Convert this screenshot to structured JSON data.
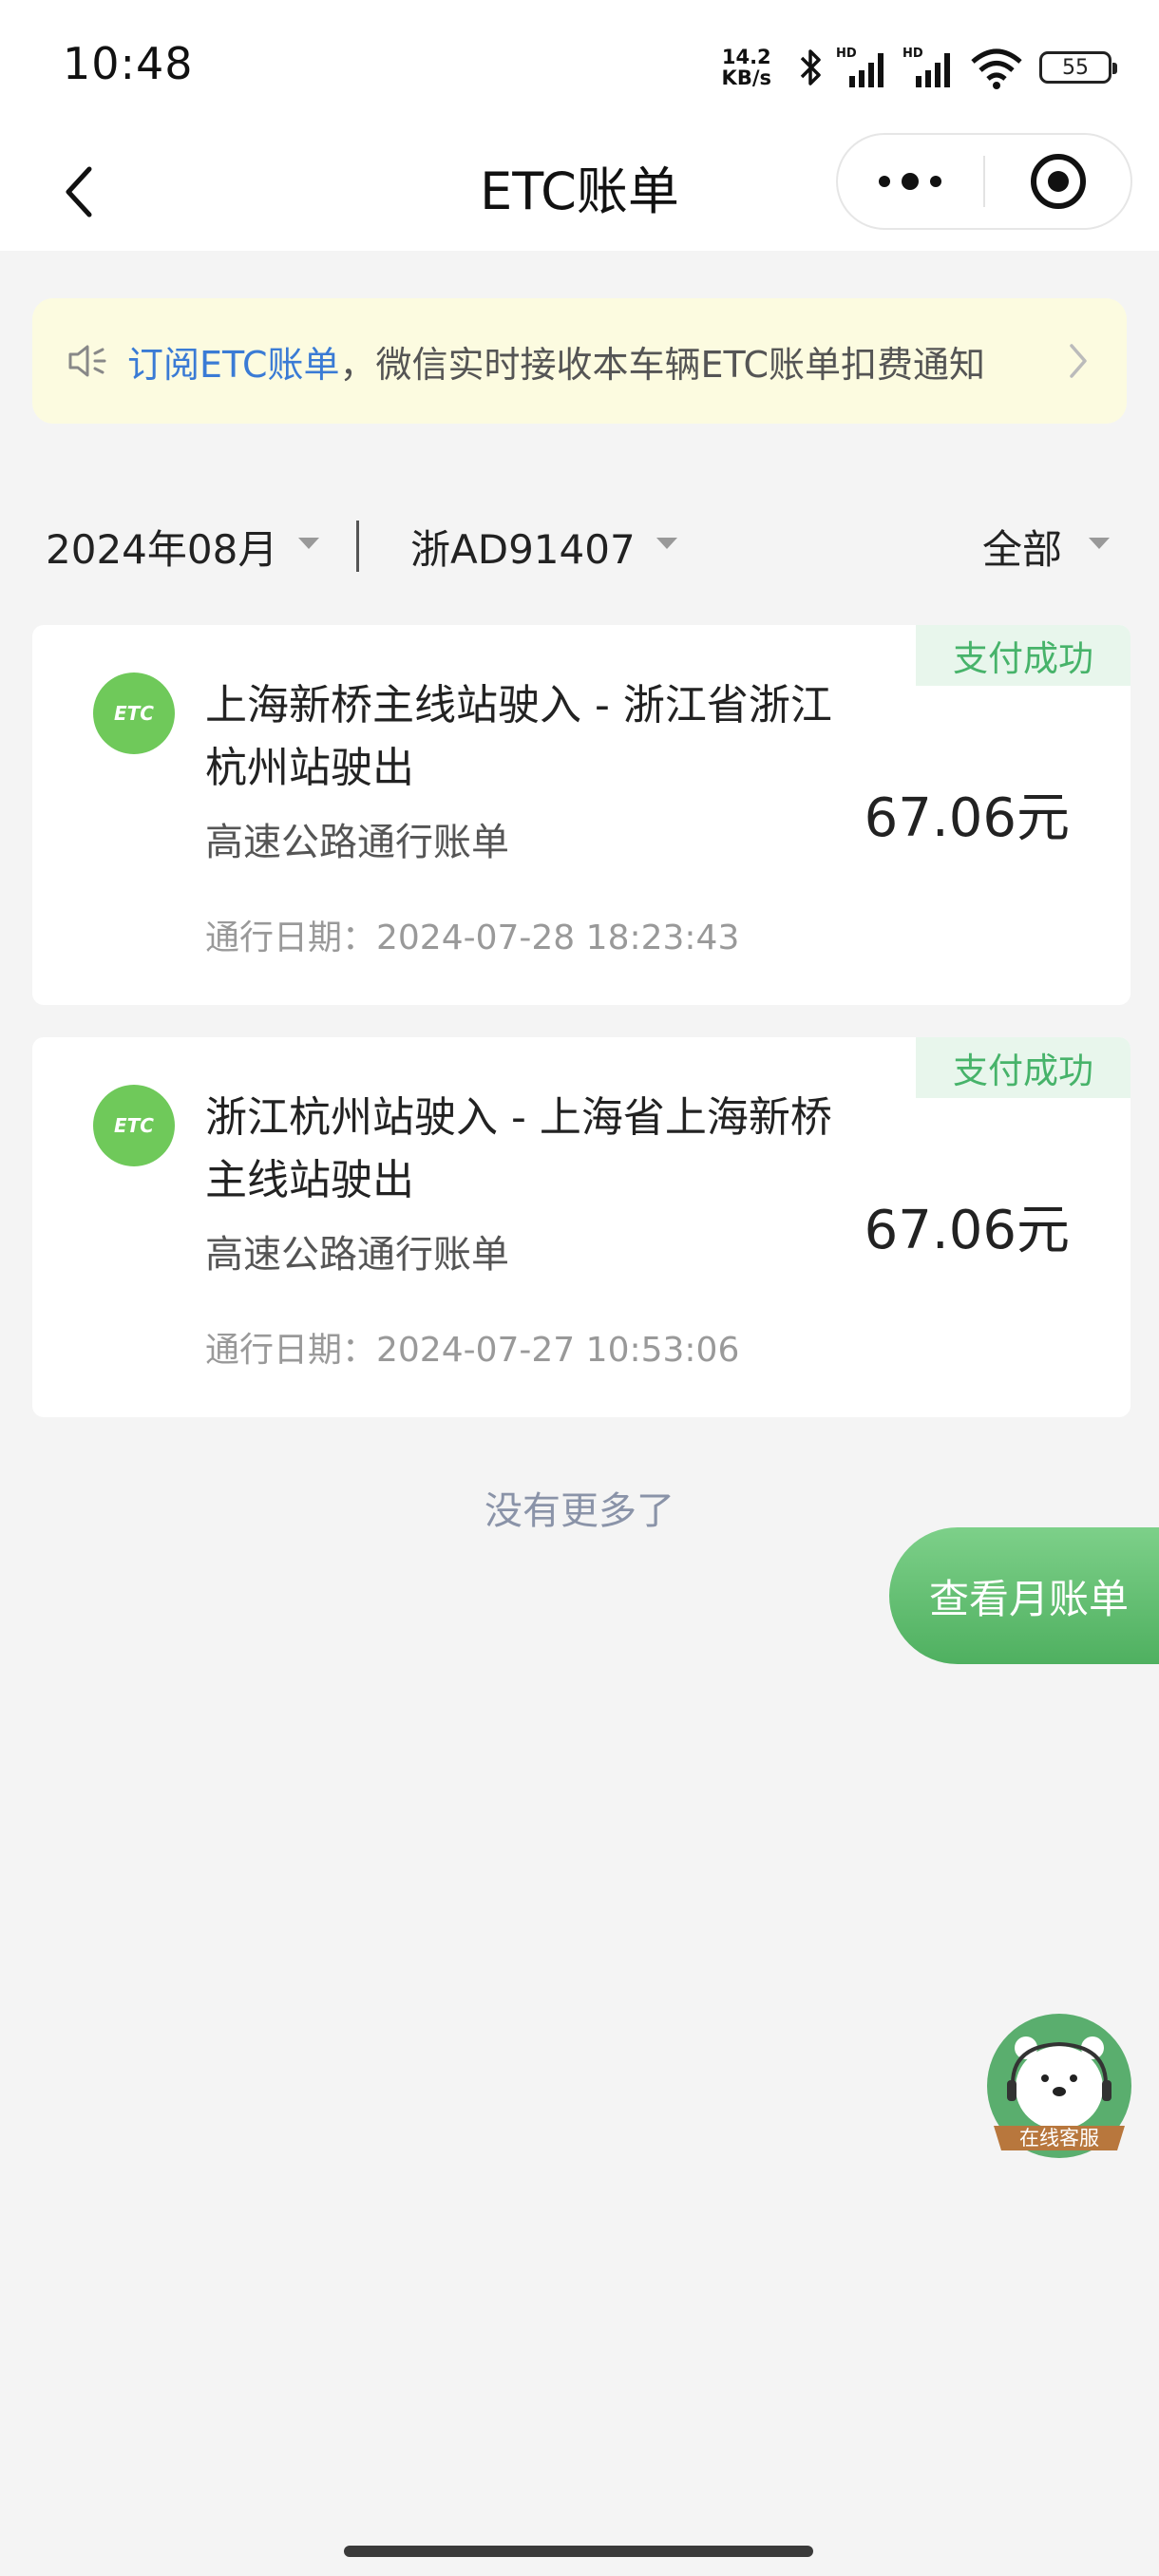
{
  "status_bar": {
    "time": "10:48",
    "net_speed_value": "14.2",
    "net_speed_unit": "KB/s",
    "battery": "55",
    "icons": [
      "bluetooth-icon",
      "signal-hd-icon",
      "signal-hd-icon",
      "wifi-icon",
      "battery-icon"
    ]
  },
  "nav": {
    "title": "ETC账单",
    "back_icon": "chevron-left-icon",
    "more_icon": "more-dots-icon",
    "close_icon": "target-close-icon"
  },
  "notice": {
    "icon": "speaker-icon",
    "link_text": "订阅ETC账单",
    "text": "，微信实时接收本车辆ETC账单扣费通知"
  },
  "filters": {
    "month": "2024年08月",
    "plate": "浙AD91407",
    "status": "全部"
  },
  "records": [
    {
      "status": "支付成功",
      "logo": "ETC",
      "route": "上海新桥主线站驶入 - 浙江省浙江杭州站驶出",
      "category": "高速公路通行账单",
      "datetime": "通行日期：2024-07-28 18:23:43",
      "amount": "67.06元"
    },
    {
      "status": "支付成功",
      "logo": "ETC",
      "route": "浙江杭州站驶入 - 上海省上海新桥主线站驶出",
      "category": "高速公路通行账单",
      "datetime": "通行日期：2024-07-27 10:53:06",
      "amount": "67.06元"
    }
  ],
  "no_more": "没有更多了",
  "monthly_bill_button": "查看月账单",
  "customer_service": "在线客服",
  "colors": {
    "accent_green": "#4fb060",
    "link_blue": "#3a7bd5",
    "notice_bg": "#fcfbe0",
    "badge_bg": "#e8f6ec"
  }
}
